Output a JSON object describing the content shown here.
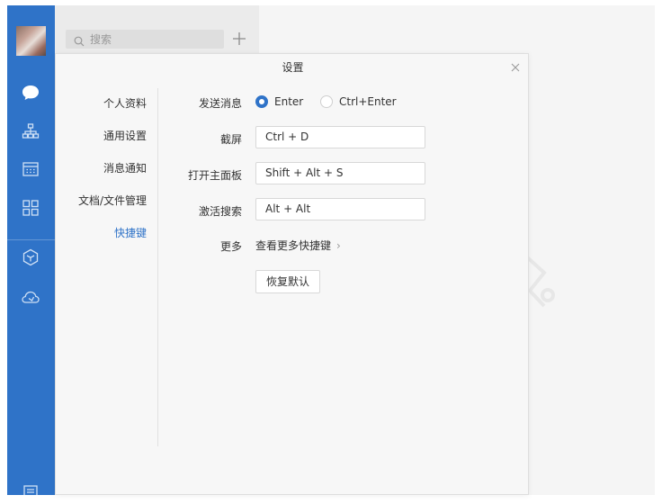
{
  "search": {
    "placeholder": "搜索"
  },
  "dialog": {
    "title": "设置",
    "menu": [
      {
        "label": "个人资料"
      },
      {
        "label": "通用设置"
      },
      {
        "label": "消息通知"
      },
      {
        "label": "文档/文件管理"
      },
      {
        "label": "快捷键",
        "active": true
      }
    ],
    "shortcuts": {
      "send_label": "发送消息",
      "send_options": [
        {
          "label": "Enter",
          "checked": true
        },
        {
          "label": "Ctrl+Enter",
          "checked": false
        }
      ],
      "rows": [
        {
          "label": "截屏",
          "value": "Ctrl + D"
        },
        {
          "label": "打开主面板",
          "value": "Shift + Alt + S"
        },
        {
          "label": "激活搜索",
          "value": "Alt + Alt"
        }
      ],
      "more_label": "更多",
      "more_link": "查看更多快捷键",
      "restore_button": "恢复默认"
    }
  },
  "sidebar": {
    "icons": [
      "chat-icon",
      "org-chart-icon",
      "calendar-icon",
      "apps-grid-icon",
      "cube-icon",
      "cloud-icon",
      "menu-icon"
    ]
  },
  "colors": {
    "accent": "#2f73c8",
    "sidebar": "#2f73c8"
  }
}
